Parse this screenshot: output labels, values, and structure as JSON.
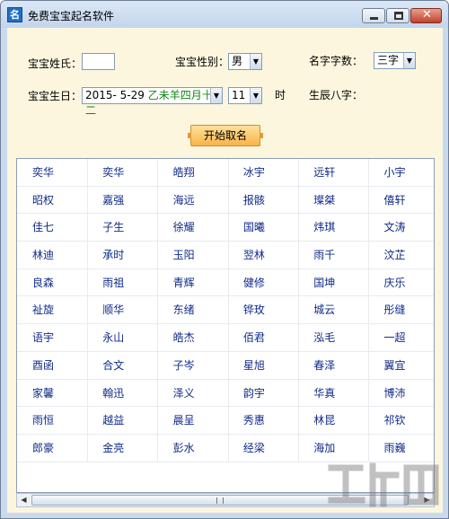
{
  "window": {
    "app_icon_char": "名",
    "title": "免费宝宝起名软件"
  },
  "form": {
    "surname_label": "宝宝姓氏：",
    "surname_value": "",
    "gender_label": "宝宝性别：",
    "gender_value": "男",
    "name_length_label": "名字字数：",
    "name_length_value": "三字",
    "birthday_label": "宝宝生日：",
    "birthday_solar": "2015- 5-29",
    "birthday_lunar": "乙未羊四月十二",
    "hour_value": "11",
    "hour_unit": "时",
    "bazi_label": "生辰八字：",
    "bazi_value": ""
  },
  "generate_button": "开始取名",
  "names": [
    [
      "奕华",
      "奕华",
      "皓翔",
      "冰宇",
      "远轩",
      "小宇"
    ],
    [
      "昭权",
      "嘉强",
      "海远",
      "报骸",
      "璨桀",
      "僖轩"
    ],
    [
      "佳七",
      "子生",
      "徐耀",
      "国曦",
      "炜琪",
      "文涛"
    ],
    [
      "林迪",
      "承时",
      "玉阳",
      "翌林",
      "雨千",
      "汶芷"
    ],
    [
      "良森",
      "雨祖",
      "青辉",
      "健修",
      "国坤",
      "庆乐"
    ],
    [
      "祉旋",
      "顺华",
      "东绪",
      "铧玫",
      "城云",
      "彤缝"
    ],
    [
      "语宇",
      "永山",
      "皓杰",
      "佰君",
      "泓毛",
      "一超"
    ],
    [
      "酉函",
      "合文",
      "子岑",
      "星旭",
      "春泽",
      "翼宜"
    ],
    [
      "家馨",
      "翰迅",
      "泽义",
      "韵宇",
      "华真",
      "博沛"
    ],
    [
      "雨恒",
      "越益",
      "晨呈",
      "秀惠",
      "林昆",
      "祁钦"
    ],
    [
      "郎豪",
      "金亮",
      "彭水",
      "经梁",
      "海加",
      "雨巍"
    ]
  ],
  "scrollbar": {
    "left_icon": "arrow-left-icon",
    "right_icon": "arrow-right-icon"
  },
  "icons": {
    "dropdown": "chevron-down-icon"
  },
  "colors": {
    "client_bg": "#fbf6dd",
    "name_text": "#102b8a",
    "lunar_text": "#118811",
    "button_orange": "#f9b34a"
  }
}
